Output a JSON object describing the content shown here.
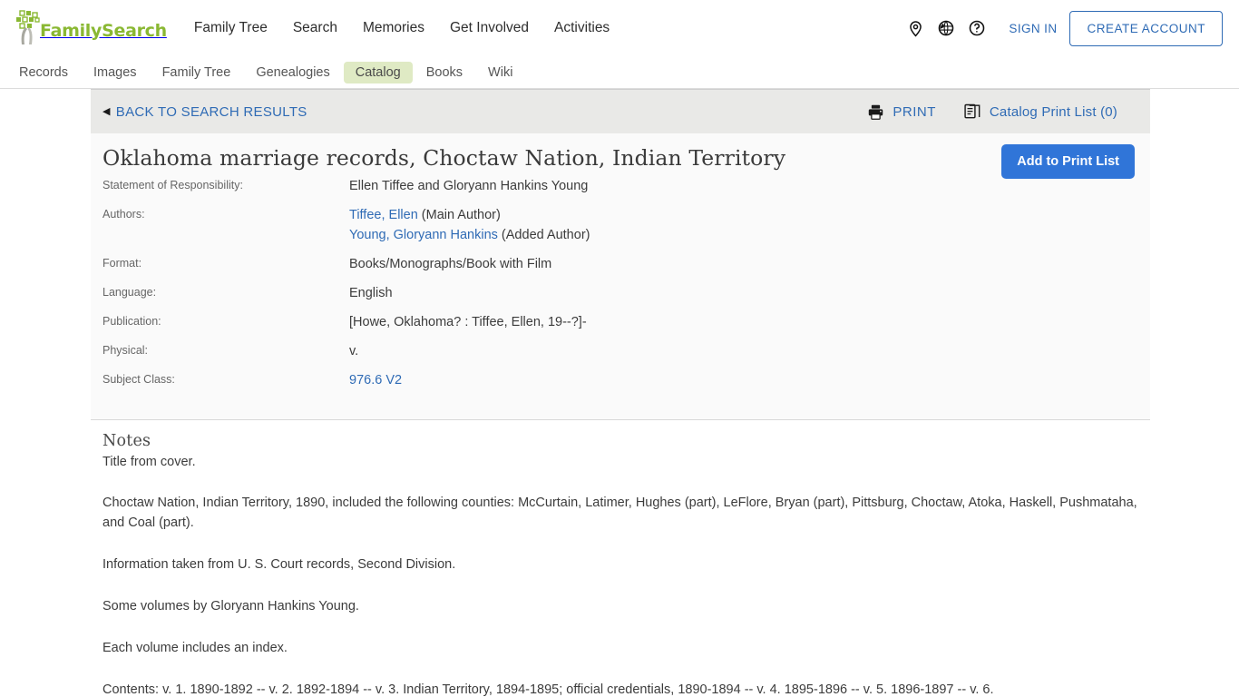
{
  "header": {
    "brand": "FamilySearch",
    "nav": [
      {
        "label": "Family Tree"
      },
      {
        "label": "Search"
      },
      {
        "label": "Memories"
      },
      {
        "label": "Get Involved"
      },
      {
        "label": "Activities"
      }
    ],
    "icons": [
      {
        "name": "map-pin-icon"
      },
      {
        "name": "globe-icon"
      },
      {
        "name": "help-circle-icon"
      }
    ],
    "sign_in": "SIGN IN",
    "create_account": "CREATE ACCOUNT"
  },
  "subnav": {
    "items": [
      {
        "label": "Records",
        "active": false
      },
      {
        "label": "Images",
        "active": false
      },
      {
        "label": "Family Tree",
        "active": false
      },
      {
        "label": "Genealogies",
        "active": false
      },
      {
        "label": "Catalog",
        "active": true
      },
      {
        "label": "Books",
        "active": false
      },
      {
        "label": "Wiki",
        "active": false
      }
    ]
  },
  "toolbar": {
    "back_label": "BACK TO SEARCH RESULTS",
    "back_caret": "◀",
    "print_label": "PRINT",
    "catalog_print_list_label": "Catalog Print List (0)"
  },
  "record": {
    "title": "Oklahoma marriage records, Choctaw Nation, Indian Territory",
    "add_to_print_list": "Add to Print List",
    "fields": [
      {
        "label": "Statement of Responsibility:",
        "value": "Ellen Tiffee and Gloryann Hankins Young"
      },
      {
        "label": "Authors:",
        "lines": [
          {
            "link": "Tiffee, Ellen",
            "suffix": " (Main Author)"
          },
          {
            "link": "Young, Gloryann Hankins",
            "suffix": " (Added Author)"
          }
        ]
      },
      {
        "label": "Format:",
        "value": "Books/Monographs/Book with Film"
      },
      {
        "label": "Language:",
        "value": "English"
      },
      {
        "label": "Publication:",
        "value": "[Howe, Oklahoma? : Tiffee, Ellen, 19--?]-"
      },
      {
        "label": "Physical:",
        "value": "v."
      },
      {
        "label": "Subject Class:",
        "link": "976.6 V2"
      }
    ]
  },
  "notes": {
    "heading": "Notes",
    "paragraphs": [
      "Title from cover.",
      "Choctaw Nation, Indian Territory, 1890, included the following counties: McCurtain, Latimer, Hughes (part), LeFlore, Bryan (part), Pittsburg, Choctaw, Atoka, Haskell, Pushmataha, and Coal (part).",
      "Information taken from U. S. Court records, Second Division.",
      "Some volumes by Gloryann Hankins Young.",
      "Each volume includes an index.",
      "Contents: v. 1. 1890-1892 -- v. 2. 1892-1894 -- v. 3. Indian Territory, 1894-1895; official credentials, 1890-1894 -- v. 4. 1895-1896 -- v. 5. 1896-1897 -- v. 6."
    ]
  },
  "colors": {
    "brand_green": "#8ab833",
    "link_blue": "#2f6bb5",
    "button_blue": "#3075d8",
    "active_tab_bg": "#dfeac4",
    "bar_gray": "#e9e9e7",
    "meta_bg": "#fafafa"
  }
}
